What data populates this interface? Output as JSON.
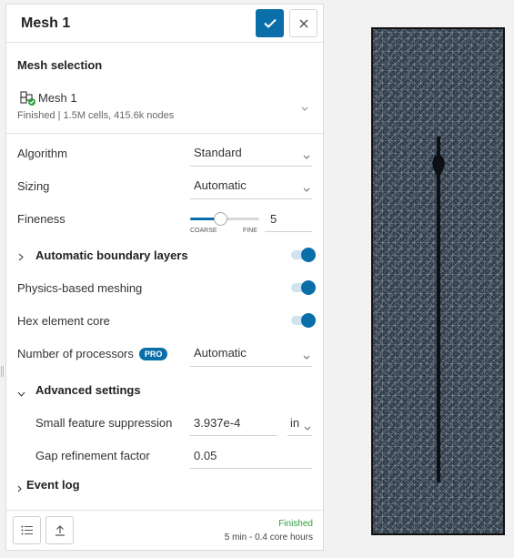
{
  "panel": {
    "title": "Mesh 1",
    "mesh_selection_title": "Mesh selection",
    "mesh": {
      "name": "Mesh 1",
      "info": "Finished | 1.5M cells, 415.6k nodes"
    },
    "fields": {
      "algorithm": {
        "label": "Algorithm",
        "value": "Standard"
      },
      "sizing": {
        "label": "Sizing",
        "value": "Automatic"
      },
      "fineness": {
        "label": "Fineness",
        "value": "5",
        "min_label": "COARSE",
        "max_label": "FINE",
        "level_fraction": 0.44
      },
      "boundary_layers": {
        "label": "Automatic boundary layers",
        "enabled": true
      },
      "physics_meshing": {
        "label": "Physics-based meshing",
        "enabled": true
      },
      "hex_core": {
        "label": "Hex element core",
        "enabled": true
      },
      "processors": {
        "label": "Number of processors",
        "badge": "PRO",
        "value": "Automatic"
      }
    },
    "advanced": {
      "label": "Advanced settings",
      "small_feature": {
        "label": "Small feature suppression",
        "value": "3.937e-4",
        "unit": "in"
      },
      "gap_factor": {
        "label": "Gap refinement factor",
        "value": "0.05"
      }
    },
    "event_log": "Event log",
    "footer": {
      "status": "Finished",
      "duration": "5 min - 0.4 core hours"
    }
  },
  "colors": {
    "accent": "#0a6fa8",
    "status_ok": "#2e9e3e",
    "mesh_bg": "#2b3744"
  },
  "icons": [
    "check-icon",
    "close-icon",
    "mesh-icon",
    "chevron-down-icon",
    "chevron-right-icon",
    "list-icon",
    "upload-icon"
  ]
}
